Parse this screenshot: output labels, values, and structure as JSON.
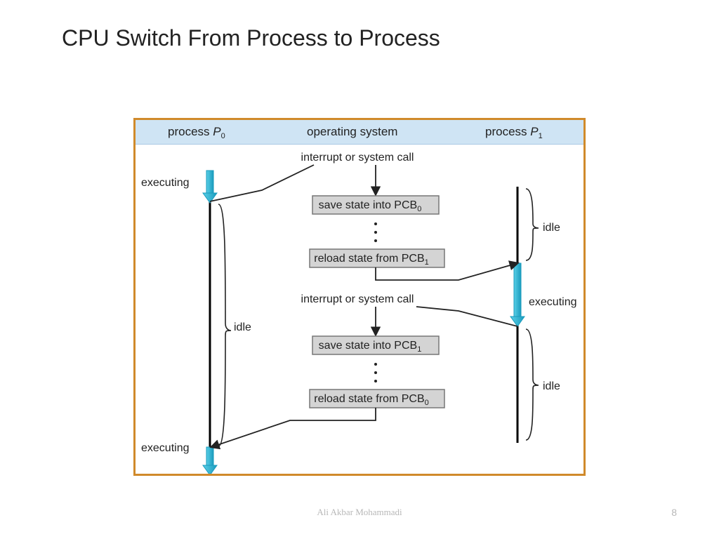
{
  "title": "CPU Switch From Process to Process",
  "footer": {
    "author": "Ali Akbar Mohammadi",
    "page": "8"
  },
  "header": {
    "left_prefix": "process ",
    "left_sym": "P",
    "left_sub": "0",
    "mid": "operating system",
    "right_prefix": "process ",
    "right_sym": "P",
    "right_sub": "1"
  },
  "labels": {
    "interrupt1": "interrupt or system call",
    "interrupt2": "interrupt or system call",
    "exec_top_left": "executing",
    "exec_bot_left": "executing",
    "exec_right": "executing",
    "idle_left": "idle",
    "idle_right_top": "idle",
    "idle_right_bot": "idle",
    "box1": "save state into PCB",
    "box1_sub": "0",
    "box2": "reload state from PCB",
    "box2_sub": "1",
    "box3": "save state into PCB",
    "box3_sub": "1",
    "box4": "reload state from PCB",
    "box4_sub": "0"
  },
  "colors": {
    "border": "#d08a2b",
    "band": "#cfe4f4",
    "box_fill": "#d4d4d4",
    "arrow_blue": "#2cb6d6",
    "arrow_blue_dark": "#1a9bbd"
  }
}
